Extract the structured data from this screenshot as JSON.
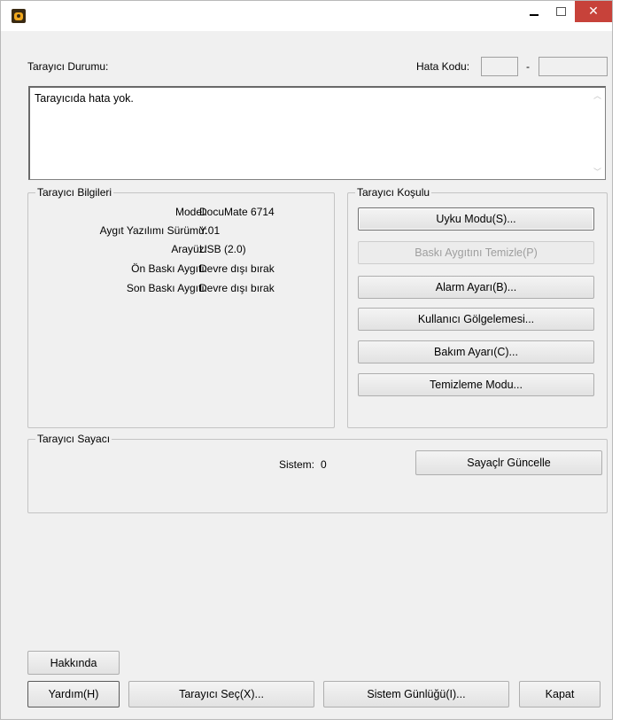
{
  "window": {
    "icon": "scanner-camera-icon",
    "controls": {
      "minimize": "minimize-icon",
      "maximize": "maximize-icon",
      "close": "close-icon",
      "close_glyph": "✕"
    }
  },
  "status": {
    "label": "Tarayıcı Durumu:",
    "error_code_label": "Hata Kodu:",
    "error_code_separator": "-",
    "error_code_1": "",
    "error_code_2": "",
    "message": "Tarayıcıda hata yok."
  },
  "info": {
    "title": "Tarayıcı Bilgileri",
    "rows": [
      {
        "key": "Model:",
        "value": "DocuMate 6714"
      },
      {
        "key": "Aygıt Yazılımı Sürümü:",
        "value": "Y.01"
      },
      {
        "key": "Arayüz:",
        "value": "USB (2.0)"
      },
      {
        "key": "Ön Baskı Aygıtı:",
        "value": "Devre dışı bırak"
      },
      {
        "key": "Son Baskı Aygıtı:",
        "value": "Devre dışı bırak"
      }
    ]
  },
  "condition": {
    "title": "Tarayıcı Koşulu",
    "buttons": [
      {
        "label": "Uyku Modu(S)...",
        "enabled": true
      },
      {
        "label": "Baskı Aygıtını Temizle(P)",
        "enabled": false
      },
      {
        "label": "Alarm Ayarı(B)...",
        "enabled": true
      },
      {
        "label": "Kullanıcı Gölgelemesi...",
        "enabled": true
      },
      {
        "label": "Bakım Ayarı(C)...",
        "enabled": true
      },
      {
        "label": "Temizleme Modu...",
        "enabled": true
      }
    ]
  },
  "counter": {
    "title": "Tarayıcı Sayacı",
    "system_label": "Sistem:",
    "system_value": "0",
    "update_button": "Sayaçlr Güncelle"
  },
  "footer": {
    "about": "Hakkında",
    "help": "Yardım(H)",
    "select_scanner": "Tarayıcı Seç(X)...",
    "system_log": "Sistem Günlüğü(I)...",
    "close": "Kapat"
  }
}
